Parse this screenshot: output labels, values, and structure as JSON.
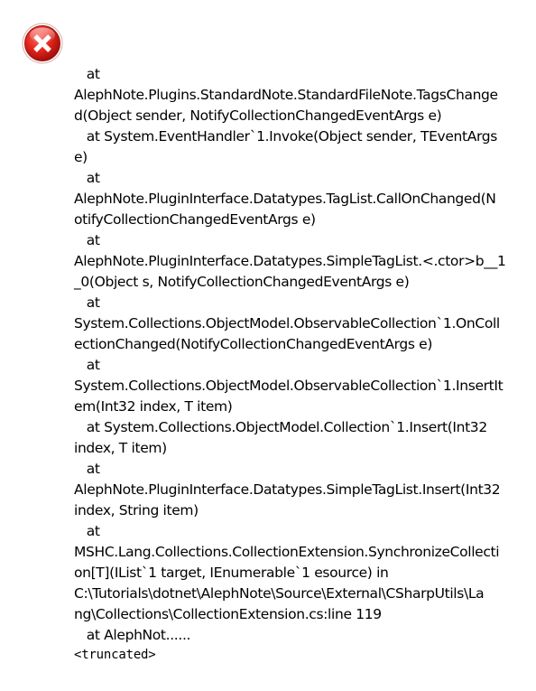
{
  "dialog": {
    "icon": "error-icon",
    "icon_color": "#d32f2f",
    "message_lines": [
      "   at",
      "AlephNote.Plugins.StandardNote.StandardFileNote.TagsChange",
      "d(Object sender, NotifyCollectionChangedEventArgs e)",
      "   at System.EventHandler`1.Invoke(Object sender, TEventArgs",
      "e)",
      "   at",
      "AlephNote.PluginInterface.Datatypes.TagList.CallOnChanged(N",
      "otifyCollectionChangedEventArgs e)",
      "   at",
      "AlephNote.PluginInterface.Datatypes.SimpleTagList.<.ctor>b__1",
      "_0(Object s, NotifyCollectionChangedEventArgs e)",
      "   at",
      "System.Collections.ObjectModel.ObservableCollection`1.OnColl",
      "ectionChanged(NotifyCollectionChangedEventArgs e)",
      "   at",
      "System.Collections.ObjectModel.ObservableCollection`1.InsertIt",
      "em(Int32 index, T item)",
      "   at System.Collections.ObjectModel.Collection`1.Insert(Int32",
      "index, T item)",
      "   at",
      "AlephNote.PluginInterface.Datatypes.SimpleTagList.Insert(Int32",
      "index, String item)",
      "   at",
      "MSHC.Lang.Collections.CollectionExtension.SynchronizeCollecti",
      "on[T](IList`1 target, IEnumerable`1 esource) in",
      "C:\\Tutorials\\dotnet\\AlephNote\\Source\\External\\CSharpUtils\\La",
      "ng\\Collections\\CollectionExtension.cs:line 119",
      "   at AlephNot......"
    ],
    "truncated_label": "<truncated>"
  }
}
